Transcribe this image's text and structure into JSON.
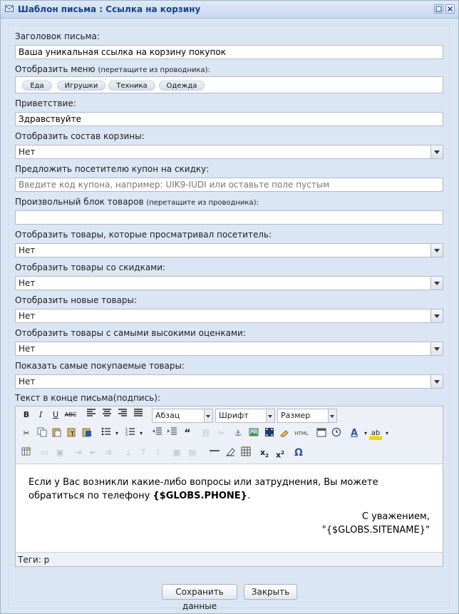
{
  "window": {
    "title": "Шаблон письма : Ссылка на корзину"
  },
  "form": {
    "subject_label": "Заголовок письма:",
    "subject_value": "Ваша уникальная ссылка на корзину покупок",
    "menu_label": "Отобразить меню",
    "menu_hint": "(перетащите из проводника):",
    "menu_items": [
      "Еда",
      "Игрушки",
      "Техника",
      "Одежда"
    ],
    "greeting_label": "Приветствие:",
    "greeting_value": "Здравствуйте",
    "cart_label": "Отобразить состав корзины:",
    "cart_value": "Нет",
    "coupon_label": "Предложить посетителю купон на скидку:",
    "coupon_placeholder": "Введите код купона, например: UIK9-IUDI или оставьте поле пустым",
    "custom_block_label": "Произвольный блок товаров",
    "custom_block_hint": "(перетащите из проводника):",
    "viewed_label": "Отобразить товары, которые просматривал посетитель:",
    "viewed_value": "Нет",
    "discount_label": "Отобразить товары со скидками:",
    "discount_value": "Нет",
    "new_label": "Отобразить новые товары:",
    "new_value": "Нет",
    "rated_label": "Отобразить товары с самыми высокими оценками:",
    "rated_value": "Нет",
    "best_label": "Показать самые покупаемые товары:",
    "best_value": "Нет",
    "signature_label": "Текст в конце письма(подпись):"
  },
  "editor": {
    "format_dropdown": "Абзац",
    "font_dropdown": "Шрифт",
    "size_dropdown": "Размер",
    "body_text": "Если у Вас возникли какие-либо вопросы или затруднения, Вы можете обратиться по телефону ",
    "phone_var": "{$GLOBS.PHONE}",
    "body_end": ".",
    "regards": "С уважением,",
    "sitename": "\"{$GLOBS.SITENAME}\"",
    "status_text": "Теги: p",
    "html_label": "HTML"
  },
  "buttons": {
    "save": "Сохранить данные",
    "close": "Закрыть"
  }
}
